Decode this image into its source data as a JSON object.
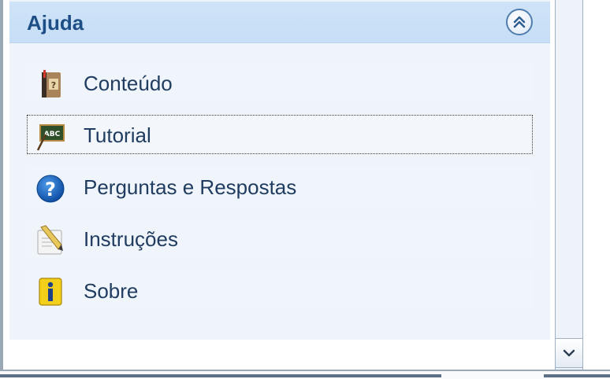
{
  "panel": {
    "title": "Ajuda",
    "items": [
      {
        "label": "Conteúdo",
        "icon": "help-book-icon"
      },
      {
        "label": "Tutorial",
        "icon": "chalkboard-abc-icon"
      },
      {
        "label": "Perguntas e Respostas",
        "icon": "question-mark-icon"
      },
      {
        "label": "Instruções",
        "icon": "document-pencil-icon"
      },
      {
        "label": "Sobre",
        "icon": "info-icon"
      }
    ]
  },
  "icons": {
    "collapse": "double-chevron-up-icon",
    "scroll_down": "chevron-down-icon"
  },
  "colors": {
    "header_bg": "#cfe3f7",
    "title_text": "#1d4f86",
    "item_text": "#203c60",
    "panel_bg": "#eff4fb"
  }
}
